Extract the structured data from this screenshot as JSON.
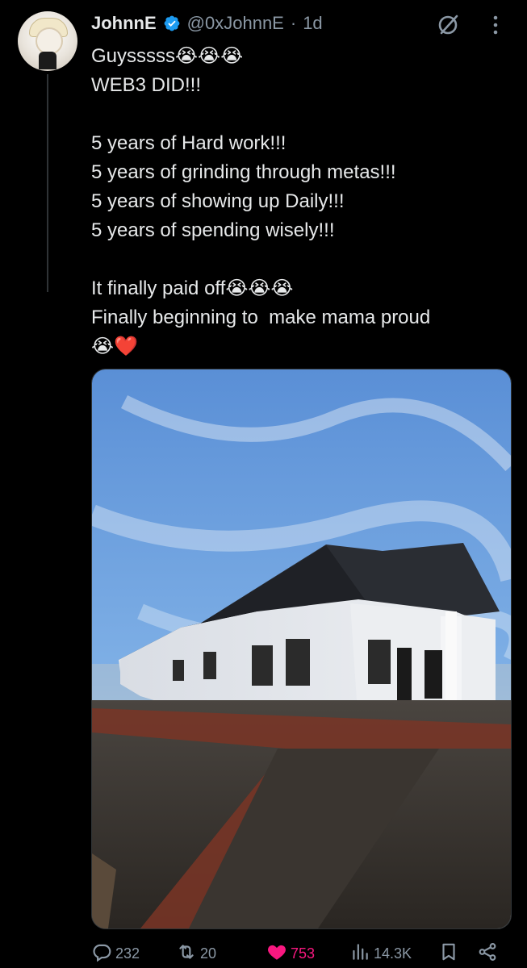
{
  "author": {
    "name": "JohnnE",
    "handle": "@0xJohnnE",
    "separator": "·",
    "time": "1d"
  },
  "tweet": {
    "lines": [
      "Guysssss😭😭😭",
      "WEB3 DID!!!",
      "",
      "5 years of Hard work!!!",
      "5 years of grinding through metas!!!",
      "5 years of showing up Daily!!!",
      "5 years of spending wisely!!!",
      "",
      "It finally paid off😭😭😭",
      "Finally beginning to  make mama proud",
      "😭❤️"
    ]
  },
  "actions": {
    "replies": "232",
    "reposts": "20",
    "likes": "753",
    "views": "14.3K"
  },
  "icons": {
    "verified": "verified-badge-icon",
    "grok": "grok-icon",
    "more": "more-icon",
    "reply": "reply-icon",
    "repost": "repost-icon",
    "like": "heart-icon",
    "views": "views-icon",
    "bookmark": "bookmark-icon",
    "share": "share-icon"
  },
  "colors": {
    "background": "#000000",
    "text": "#e7e9ea",
    "muted": "#8b98a5",
    "verified": "#1d9bf0",
    "like": "#f91880"
  }
}
